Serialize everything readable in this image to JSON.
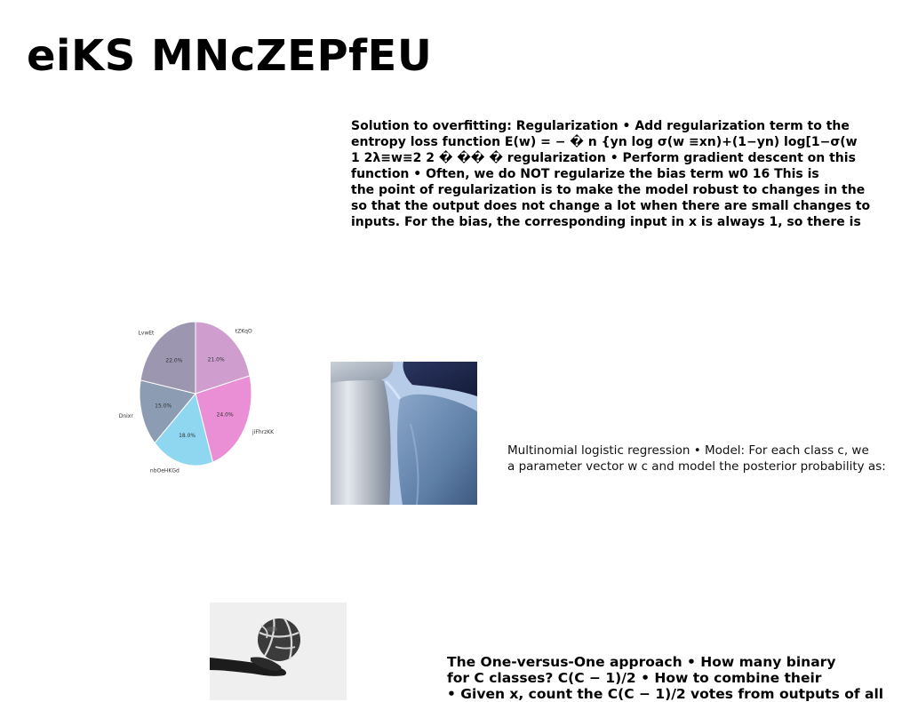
{
  "slide": {
    "title": "eiKS MNcZEPfEU"
  },
  "text_blocks": {
    "regularization": {
      "lines": [
        "Solution to overfitting: Regularization • Add regularization term to the",
        "entropy loss function E(w) = − � n {yn log σ(w ≡xn)+(1−yn) log[1−σ(w",
        "1 2λ≡w≡2 2 � �� � regularization • Perform gradient descent on this",
        "function • Often, we do NOT regularize the bias term w0 16 This is",
        "the point of regularization is to make the model robust to changes in the",
        "so that the output does not change a lot when there are small changes to",
        "inputs. For the bias, the corresponding input in x is always 1, so there is"
      ]
    },
    "multinomial": {
      "lines": [
        "Multinomial logistic regression • Model: For each class c, we",
        "a parameter vector w c and model the posterior probability as:"
      ]
    },
    "one_vs_one": {
      "lines": [
        "The One-versus-One approach • How many binary",
        "for C classes? C(C − 1)/2 • How to combine their",
        "• Given x, count the C(C − 1)/2 votes from outputs of all"
      ]
    }
  },
  "chart_data": {
    "type": "pie",
    "title": "",
    "categories": [
      "tZKqO",
      "jiFhrzKK",
      "nbOeHKGd",
      "Dnixr",
      "LvwEt"
    ],
    "values": [
      21.0,
      24.0,
      18.0,
      15.0,
      22.0
    ],
    "value_labels": [
      "21.0%",
      "24.0%",
      "18.0%",
      "15.0%",
      "22.0%"
    ],
    "colors": [
      "#cf9ecf",
      "#ea8fd6",
      "#8fd7f0",
      "#8c9cb2",
      "#9c96b0"
    ],
    "start_angle_deg": 90,
    "direction": "clockwise",
    "legend": "none"
  },
  "images": {
    "abstract": {
      "icon": "abstract-3d-tiles-image",
      "colors": {
        "light": "#c4cdd8",
        "mid": "#6f8fb3",
        "dark": "#1f2a4a",
        "glow": "#a9c6f0"
      }
    },
    "basketball": {
      "icon": "hand-holding-basketball-image",
      "colors": {
        "background": "#efefef",
        "ball": "#3a3a3a",
        "arm": "#1a1a1a"
      }
    }
  }
}
